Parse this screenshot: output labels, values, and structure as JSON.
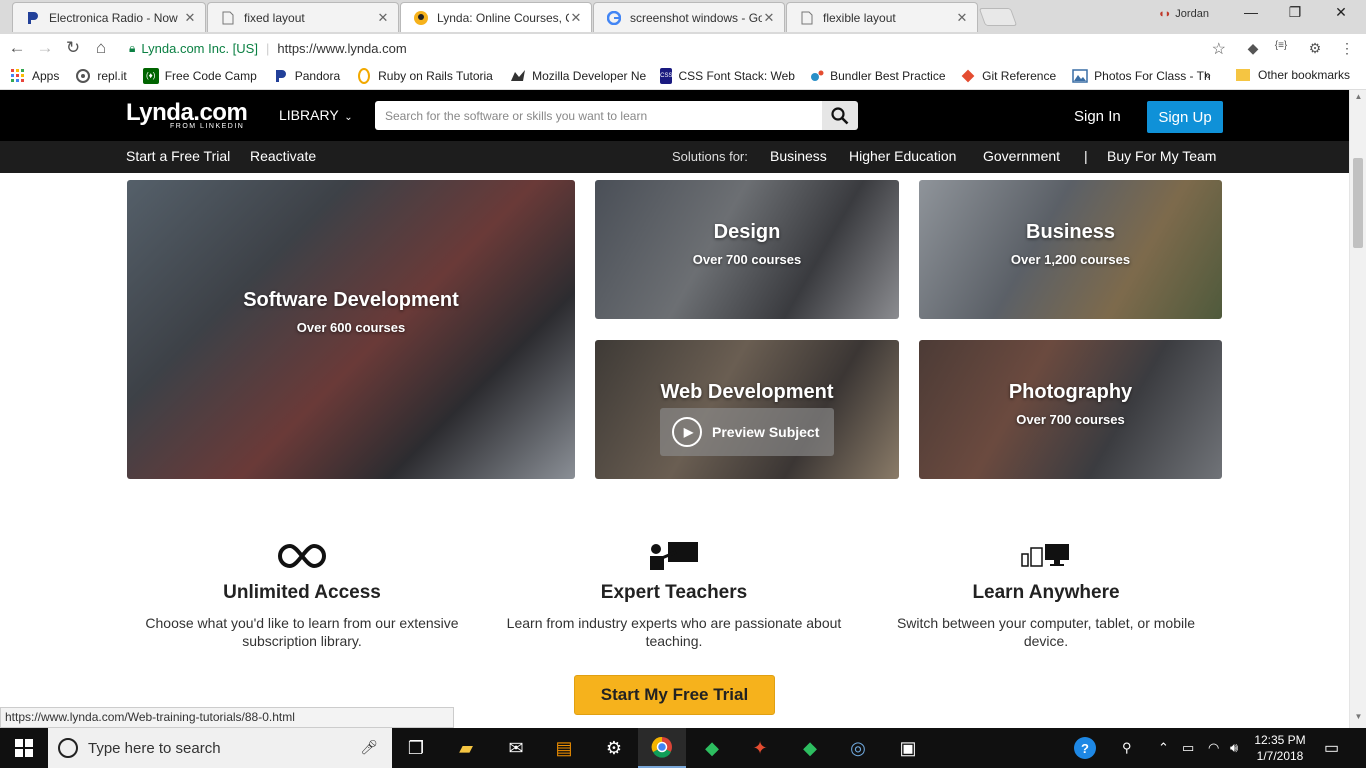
{
  "browser": {
    "tabs": [
      {
        "title": "Electronica Radio - Now",
        "favicon": "pandora-icon",
        "active": false
      },
      {
        "title": "fixed layout",
        "favicon": "document-icon",
        "active": false
      },
      {
        "title": "Lynda: Online Courses, C",
        "favicon": "lynda-icon",
        "active": true
      },
      {
        "title": "screenshot windows - Go",
        "favicon": "google-icon",
        "active": false
      },
      {
        "title": "flexible layout",
        "favicon": "document-icon",
        "active": false
      }
    ],
    "profile_name": "Jordan",
    "secure_label": "Lynda.com Inc. [US]",
    "url": "https://www.lynda.com",
    "bookmarks": [
      {
        "label": "Apps",
        "icon": "apps-grid-icon",
        "color": "#e8453c"
      },
      {
        "label": "repl.it",
        "icon": "replit-icon",
        "color": "#555555"
      },
      {
        "label": "Free Code Camp",
        "icon": "freecodecamp-icon",
        "color": "#006400"
      },
      {
        "label": "Pandora",
        "icon": "pandora-icon",
        "color": "#224099"
      },
      {
        "label": "Ruby on Rails Tutoria",
        "icon": "rails-icon",
        "color": "#f2a900"
      },
      {
        "label": "Mozilla Developer Ne",
        "icon": "mozilla-icon",
        "color": "#333333"
      },
      {
        "label": "CSS Font Stack: Web",
        "icon": "cssfontstack-icon",
        "color": "#1a1a80"
      },
      {
        "label": "Bundler Best Practice",
        "icon": "bundler-icon",
        "color": "#2a8fc7"
      },
      {
        "label": "Git Reference",
        "icon": "git-icon",
        "color": "#e44c30"
      },
      {
        "label": "Photos For Class - Th",
        "icon": "photos-icon",
        "color": "#3a6ea5"
      }
    ],
    "bookmarks_more": "»",
    "other_bookmarks": "Other bookmarks",
    "status_url": "https://www.lynda.com/Web-training-tutorials/88-0.html"
  },
  "lynda": {
    "logo": "Lynda.com",
    "logo_sub": "FROM LINKEDIN",
    "library": "LIBRARY",
    "search_placeholder": "Search for the software or skills you want to learn",
    "sign_in": "Sign In",
    "sign_up": "Sign Up",
    "nav": {
      "free_trial": "Start a Free Trial",
      "reactivate": "Reactivate",
      "solutions_label": "Solutions for:",
      "business": "Business",
      "higher_ed": "Higher Education",
      "government": "Government",
      "divider": "|",
      "buy_team": "Buy For My Team"
    },
    "tiles": [
      {
        "title": "Software Development",
        "sub": "Over 600 courses"
      },
      {
        "title": "Design",
        "sub": "Over 700 courses"
      },
      {
        "title": "Business",
        "sub": "Over 1,200 courses"
      },
      {
        "title": "Web Development",
        "preview": "Preview Subject"
      },
      {
        "title": "Photography",
        "sub": "Over 700 courses"
      }
    ],
    "features": [
      {
        "title": "Unlimited Access",
        "desc": "Choose what you'd like to learn from our extensive subscription library.",
        "icon": "infinity-icon"
      },
      {
        "title": "Expert Teachers",
        "desc": "Learn from industry experts who are passionate about teaching.",
        "icon": "teacher-icon"
      },
      {
        "title": "Learn Anywhere",
        "desc": "Switch between your computer, tablet, or mobile device.",
        "icon": "devices-icon"
      }
    ],
    "cta": "Start My Free Trial",
    "accent": "#0f91d8",
    "cta_color": "#f6b21c"
  },
  "taskbar": {
    "search_placeholder": "Type here to search",
    "time": "12:35 PM",
    "date": "1/7/2018"
  }
}
